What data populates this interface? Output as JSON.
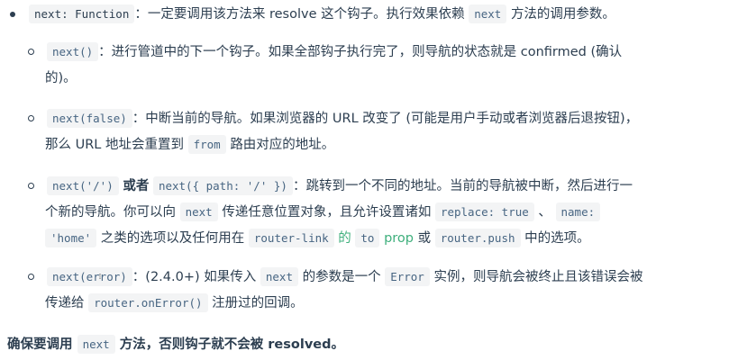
{
  "item1": {
    "code_a": "next: Function",
    "text_a": "：一定要调用该方法来 resolve 这个钩子。执行效果依赖",
    "code_b": "next",
    "text_b": "方法的调用参数。"
  },
  "item2": {
    "code_a": "next()",
    "text_a": "：进行管道中的下一个钩子。如果全部钩子执行完了，则导航的状态就是 confirmed (确认",
    "text_b": "的)。"
  },
  "item3": {
    "code_a": "next(false)",
    "text_a": "：中断当前的导航。如果浏览器的 URL 改变了 (可能是用户手动或者浏览器后退按钮)，",
    "text_b": "那么 URL 地址会重置到",
    "code_b": "from",
    "text_c": "路由对应的地址。"
  },
  "item4": {
    "code_a": "next('/')",
    "text_or": "或者",
    "code_b": "next({ path: '/' })",
    "text_a": "：跳转到一个不同的地址。当前的导航被中断，然后进行一",
    "text_b": "个新的导航。你可以向",
    "code_c": "next",
    "text_c": "传递任意位置对象，且允许设置诸如",
    "code_d": "replace: true",
    "text_d": "、",
    "code_e": "name:",
    "code_f": "'home'",
    "text_e": "之类的选项以及任何用在",
    "code_g": "router-link",
    "link_a": "的",
    "link_b": "to",
    "link_c": "prop",
    "text_f": "或",
    "code_h": "router.push",
    "text_g": "中的选项。"
  },
  "item5": {
    "code_a": "next(error)",
    "text_a": "：(2.4.0+) 如果传入",
    "code_b": "next",
    "text_b": "的参数是一个",
    "code_c": "Error",
    "text_c": "实例，则导航会被终止且该错误会被",
    "text_d": "传递给",
    "code_d": "router.onError()",
    "text_e": "注册过的回调。"
  },
  "footer": {
    "text_a": "确保要调用",
    "code_a": "next",
    "text_b": "方法，否则钩子就不会被 resolved。"
  }
}
